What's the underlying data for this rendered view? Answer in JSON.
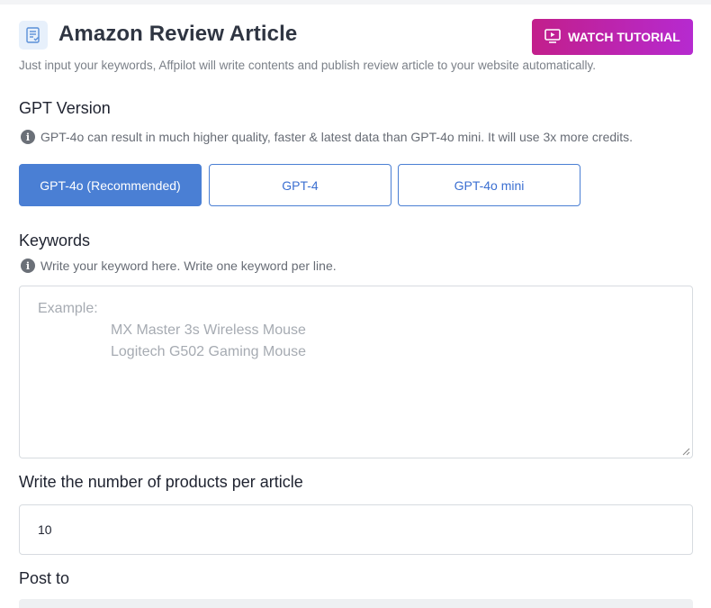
{
  "header": {
    "icon": "document-list-icon",
    "title": "Amazon Review Article",
    "subtitle": "Just input your keywords, Affpilot will write contents and publish review article to your website automatically.",
    "watch_button": {
      "label": "WATCH TUTORIAL",
      "icon": "video-play-icon"
    }
  },
  "gpt_version": {
    "label": "GPT Version",
    "hint": "GPT-4o can result in much higher quality, faster & latest data than GPT-4o mini. It will use 3x more credits.",
    "options": [
      {
        "label": "GPT-4o (Recommended)",
        "selected": true
      },
      {
        "label": "GPT-4",
        "selected": false
      },
      {
        "label": "GPT-4o mini",
        "selected": false
      }
    ]
  },
  "keywords": {
    "label": "Keywords",
    "hint": "Write your keyword here. Write one keyword per line.",
    "placeholder": {
      "prefix": "Example:",
      "lines": [
        "MX Master 3s Wireless Mouse",
        "Logitech G502 Gaming Mouse"
      ]
    }
  },
  "products_per_article": {
    "label": "Write the number of products per article",
    "value": "10"
  },
  "post_to": {
    "label": "Post to"
  },
  "colors": {
    "primary": "#4a7fd4",
    "watch_gradient_start": "#c21f8b",
    "watch_gradient_end": "#b62ad0",
    "icon_bg": "#e7f0fb"
  }
}
